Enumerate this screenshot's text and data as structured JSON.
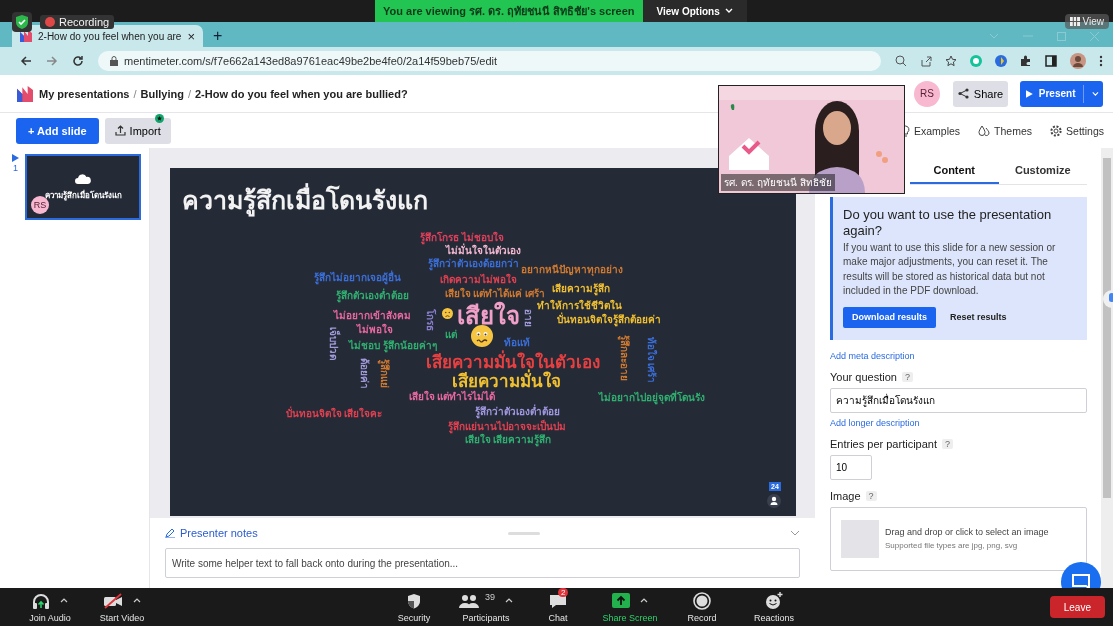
{
  "zoom_top": {
    "recording": "Recording",
    "banner": "You are viewing รศ. ดร. ฤทัยชนนี สิทธิชัย's screen",
    "view_options": "View Options",
    "view": "View"
  },
  "browser": {
    "tab": {
      "title": "2-How do you feel when you are",
      "close": "×"
    },
    "new_tab": "+",
    "url": "mentimeter.com/s/f7e662a143ed8a9761eac49be2be4fe0/2a14f59beb75/edit"
  },
  "header": {
    "breadcrumb": [
      {
        "label": "My presentations",
        "kind": "crumb"
      },
      {
        "label": "/",
        "kind": "separator"
      },
      {
        "label": "Bullying",
        "kind": "crumb"
      },
      {
        "label": "/",
        "kind": "separator"
      },
      {
        "label": "2-How do you feel when you are bullied?",
        "kind": "crumb"
      }
    ],
    "avatar": "RS",
    "share": "Share",
    "present": "Present"
  },
  "toolbar": {
    "add_slide": "+ Add slide",
    "import": "Import",
    "links": [
      "Examples",
      "Themes",
      "Settings"
    ]
  },
  "slides": [
    {
      "number": "1",
      "title": "ความรู้สึกเมื่อโดนรังแก",
      "avatar": "RS",
      "selected": true
    }
  ],
  "slide": {
    "title": "ความรู้สึกเมื่อโดนรังแก",
    "participants": "24",
    "words": [
      {
        "text": "รู้สึกโกรธ ไม่ชอบใจ",
        "kind": "word",
        "color": "#e0405a"
      },
      {
        "text": "ไม่มั่นใจในตัวเอง",
        "kind": "word",
        "color": "#f2b8d0"
      },
      {
        "text": "รู้สึกว่าตัวเองด้อยกว่า",
        "kind": "word",
        "color": "#3b6fd8"
      },
      {
        "text": "เกิดความไม่พอใจ",
        "kind": "word",
        "color": "#e04050"
      },
      {
        "text": "เสียใจ แต่ทำได้แค่ เศร้า",
        "kind": "word",
        "color": "#d07a30"
      },
      {
        "text": "เสียใจ",
        "kind": "top",
        "color": "#f0a0c8"
      },
      {
        "text": "โกรธ",
        "kind": "vertical",
        "color": "#8a80d0"
      },
      {
        "text": "แต่",
        "kind": "word",
        "color": "#2fb070"
      },
      {
        "text": "อาย",
        "kind": "vertical",
        "color": "#a09ad8"
      },
      {
        "text": "ท้อแท้",
        "kind": "word",
        "color": "#3b6fd8"
      },
      {
        "text": "รู้สึกไม่อยากเจอผู้อื่น",
        "kind": "word",
        "color": "#3b6fd8"
      },
      {
        "text": "รู้สึกตัวเองต่ำต้อย",
        "kind": "word",
        "color": "#2fb070"
      },
      {
        "text": "ไม่อยากเข้าสังคม",
        "kind": "word",
        "color": "#e868a0"
      },
      {
        "text": "ไม่พอใจ",
        "kind": "word",
        "color": "#e868a0"
      },
      {
        "text": "ไม่ชอบ รู้สึกน้อยค่าๆ",
        "kind": "word",
        "color": "#2fb070"
      },
      {
        "text": "เจ็บปวด",
        "kind": "vertical",
        "color": "#a09ad8"
      },
      {
        "text": "ด้อยค่า",
        "kind": "vertical",
        "color": "#a09ad8"
      },
      {
        "text": "รู้สึกแย่",
        "kind": "vertical",
        "color": "#d07a30"
      },
      {
        "text": "เสียความมั่นใจในตัวเอง",
        "kind": "big",
        "color": "#e84040"
      },
      {
        "text": "เสียความมั่นใจ",
        "kind": "big",
        "color": "#f0c030"
      },
      {
        "text": "เสียใจ แต่ทำไรไม่ได้",
        "kind": "word",
        "color": "#e868a0"
      },
      {
        "text": "บั่นทอนจิตใจ เสียใจคะ",
        "kind": "word",
        "color": "#e04050"
      },
      {
        "text": "รู้สึกว่าตัวเองต่ำต้อย",
        "kind": "word",
        "color": "#a098e0"
      },
      {
        "text": "รู้สึกแย่นานไปอาจจะเป็นปม",
        "kind": "word",
        "color": "#e04050"
      },
      {
        "text": "เสียใจ เสียความรู้สึก",
        "kind": "word",
        "color": "#2fb070"
      },
      {
        "text": "อยากหนีปัญหาทุกอย่าง",
        "kind": "word",
        "color": "#d07a30"
      },
      {
        "text": "เสียความรู้สึก",
        "kind": "word",
        "color": "#f0c030"
      },
      {
        "text": "ทำให้การใช้ชีวิตใน",
        "kind": "word",
        "color": "#f0c030"
      },
      {
        "text": "บั่นทอนจิตใจรู้สึกต้อยค่า",
        "kind": "word",
        "color": "#f0c030"
      },
      {
        "text": "รู้สึกละอาย",
        "kind": "vertical",
        "color": "#d07a30"
      },
      {
        "text": "ท้อใจ เศร้า",
        "kind": "vertical",
        "color": "#3b6fd8"
      },
      {
        "text": "ไม่อยากไปอยู่จุดที่โดนรัง",
        "kind": "word",
        "color": "#2fb070"
      }
    ]
  },
  "notes": {
    "label": "Presenter notes",
    "placeholder": "Write some helper text to fall back onto during the presentation..."
  },
  "panel": {
    "tabs": [
      {
        "label": "Content",
        "selected": true
      },
      {
        "label": "Customize",
        "selected": false
      }
    ],
    "notice": {
      "title": "Do you want to use the presentation again?",
      "body": "If you want to use this slide for a new session or make major adjustments, you can reset it. The results will be stored as historical data but not included in the PDF download.",
      "download": "Download results",
      "reset": "Reset results"
    },
    "meta_link": "Add meta description",
    "question_label": "Your question",
    "question": "ความรู้สึกเมื่อโดนรังแก",
    "longer_link": "Add longer description",
    "entries_label": "Entries per participant",
    "entries": "10",
    "image_label": "Image",
    "help": "?",
    "drop_text": "Drag and drop or click to select an image",
    "drop_hint": "Supported file types are jpg, png, svg"
  },
  "video": {
    "caption": "รศ. ดร. ฤทัยชนนี สิทธิชัย"
  },
  "zoom_bar": {
    "items": [
      {
        "label": "Join Audio",
        "kind": "audio",
        "caret": true
      },
      {
        "label": "Start Video",
        "kind": "video",
        "caret": true
      },
      {
        "label": "Security",
        "kind": "security",
        "caret": false
      },
      {
        "label": "Participants",
        "kind": "participants",
        "count": "39",
        "caret": true
      },
      {
        "label": "Chat",
        "kind": "chat",
        "badge": "2",
        "caret": false
      },
      {
        "label": "Share Screen",
        "kind": "share",
        "caret": true
      },
      {
        "label": "Record",
        "kind": "record",
        "caret": false
      },
      {
        "label": "Reactions",
        "kind": "reactions",
        "caret": false
      }
    ],
    "leave": "Leave"
  }
}
